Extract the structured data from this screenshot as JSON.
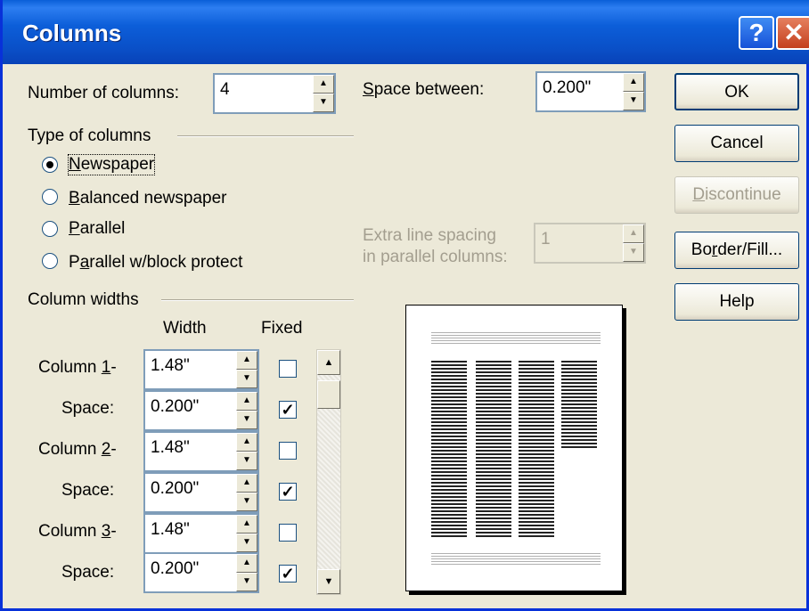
{
  "window": {
    "title": "Columns",
    "help_glyph": "?",
    "close_glyph": "✕"
  },
  "number_of_columns": {
    "label": "Number of columns:",
    "value": "4"
  },
  "space_between": {
    "label_u": "S",
    "label_rest": "pace between:",
    "value": "0.200\""
  },
  "type_group": {
    "label": "Type of columns",
    "options": [
      {
        "u": "N",
        "rest": "ewspaper",
        "selected": true
      },
      {
        "u": "B",
        "rest": "alanced newspaper",
        "selected": false
      },
      {
        "u": "P",
        "rest": "arallel",
        "selected": false
      },
      {
        "pre": "P",
        "u": "a",
        "rest": "rallel w/block protect",
        "selected": false
      }
    ]
  },
  "extra_spacing": {
    "line1": "Extra line spacing",
    "line2": "in parallel columns:",
    "value": "1"
  },
  "buttons": {
    "ok": "OK",
    "cancel": "Cancel",
    "discontinue_u": "D",
    "discontinue_rest": "iscontinue",
    "border_pre": "Bo",
    "border_u": "r",
    "border_rest": "der/Fill...",
    "help": "Help"
  },
  "widths_group": {
    "label": "Column widths",
    "col_width_header": "Width",
    "col_fixed_header": "Fixed",
    "rows": [
      {
        "pre": "Column ",
        "u": "1",
        "post": "-",
        "value": "1.48\"",
        "fixed": false
      },
      {
        "pre": "Space:",
        "u": "",
        "post": "",
        "value": "0.200\"",
        "fixed": true
      },
      {
        "pre": "Column ",
        "u": "2",
        "post": "-",
        "value": "1.48\"",
        "fixed": false
      },
      {
        "pre": "Space:",
        "u": "",
        "post": "",
        "value": "0.200\"",
        "fixed": true
      },
      {
        "pre": "Column ",
        "u": "3",
        "post": "-",
        "value": "1.48\"",
        "fixed": false
      },
      {
        "pre": "Space:",
        "u": "",
        "post": "",
        "value": "0.200\"",
        "fixed": true
      }
    ]
  },
  "icons": {
    "spin_up": "▲",
    "spin_down": "▼",
    "check": "✓"
  }
}
